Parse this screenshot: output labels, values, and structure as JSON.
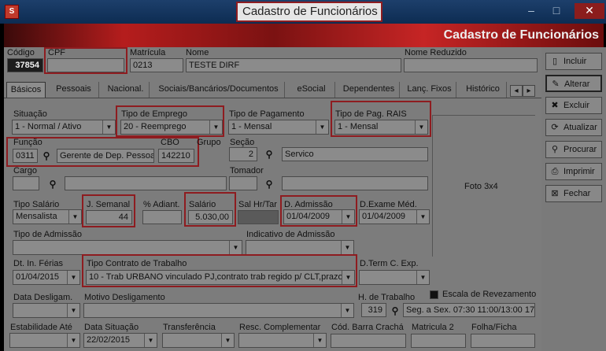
{
  "window": {
    "title": "Cadastro de Funcionários",
    "banner_title": "Cadastro de Funcionários",
    "minimize": "–",
    "maximize": "□",
    "close": "✕"
  },
  "header": {
    "codigo_label": "Código",
    "codigo_value": "37854",
    "cpf_label": "CPF",
    "cpf_value": "",
    "matricula_label": "Matrícula",
    "matricula_value": "0213",
    "nome_label": "Nome",
    "nome_value": "TESTE DIRF",
    "nome_reduzido_label": "Nome Reduzido",
    "nome_reduzido_value": ""
  },
  "tabs": [
    "Básicos",
    "Pessoais",
    "Nacional.",
    "Sociais/Bancários/Documentos",
    "eSocial",
    "Dependentes",
    "Lanç. Fixos",
    "Histórico"
  ],
  "tab_scroll": {
    "left": "◂",
    "right": "▸"
  },
  "form": {
    "situacao_label": "Situação",
    "situacao_value": "1 - Normal / Ativo",
    "tipo_emprego_label": "Tipo de Emprego",
    "tipo_emprego_value": "20 - Reemprego",
    "tipo_pagamento_label": "Tipo de Pagamento",
    "tipo_pagamento_value": "1 - Mensal",
    "tipo_pag_rais_label": "Tipo de Pag. RAIS",
    "tipo_pag_rais_value": "1 - Mensal",
    "funcao_label": "Função",
    "funcao_code": "0311",
    "funcao_desc": "Gerente de Dep. Pessoa",
    "cbo_label": "CBO",
    "cbo_value": "142210",
    "grupo_label": "Grupo",
    "secao_label": "Seção",
    "secao_code": "2",
    "secao_desc": "Servico",
    "cargo_label": "Cargo",
    "cargo_code": "",
    "cargo_desc": "",
    "tomador_label": "Tomador",
    "tomador_code": "",
    "tomador_desc": "",
    "foto_label": "Foto 3x4",
    "tipo_salario_label": "Tipo Salário",
    "tipo_salario_value": "Mensalista",
    "j_semanal_label": "J. Semanal",
    "j_semanal_value": "44",
    "adiant_label": "% Adiant.",
    "adiant_value": "",
    "salario_label": "Salário",
    "salario_value": "5.030,00",
    "sal_hr_label": "Sal Hr/Tar",
    "d_admissao_label": "D. Admissão",
    "d_admissao_value": "01/04/2009",
    "d_exame_label": "D.Exame Méd.",
    "d_exame_value": "01/04/2009",
    "tipo_admissao_label": "Tipo de Admissão",
    "tipo_admissao_value": "",
    "indicativo_admissao_label": "Indicativo de Admissão",
    "indicativo_admissao_value": "",
    "dt_ferias_label": "Dt. In. Férias",
    "dt_ferias_value": "01/04/2015",
    "tipo_contrato_label": "Tipo Contrato de Trabalho",
    "tipo_contrato_value": "10 - Trab URBANO vinculado PJ,contrato trab regido p/ CLT,prazo i",
    "d_term_label": "D.Term C. Exp.",
    "d_term_value": "",
    "data_deslig_label": "Data Desligam.",
    "data_deslig_value": "",
    "motivo_deslig_label": "Motivo Desligamento",
    "motivo_deslig_value": "",
    "h_trabalho_label": "H. de Trabalho",
    "h_trabalho_code": "319",
    "h_trabalho_desc": "Seg. a Sex. 07:30 11:00/13:00 17",
    "escala_label": "Escala de Revezamento",
    "estabilidade_label": "Estabilidade Até",
    "estabilidade_value": "",
    "data_situacao_label": "Data Situação",
    "data_situacao_value": "22/02/2015",
    "transferencia_label": "Transferência",
    "transferencia_value": "",
    "resc_label": "Resc. Complementar",
    "resc_value": "",
    "cod_barra_label": "Cód. Barra Crachá",
    "cod_barra_value": "",
    "matricula2_label": "Matricula 2",
    "matricula2_value": "",
    "folha_label": "Folha/Ficha",
    "folha_value": ""
  },
  "sidebar": {
    "incluir": "Incluir",
    "alterar": "Alterar",
    "excluir": "Excluir",
    "atualizar": "Atualizar",
    "procurar": "Procurar",
    "imprimir": "Imprimir",
    "fechar": "Fechar"
  },
  "icons": {
    "lookup": "binoculars-icon",
    "dropdown": "chevron-down-icon"
  }
}
